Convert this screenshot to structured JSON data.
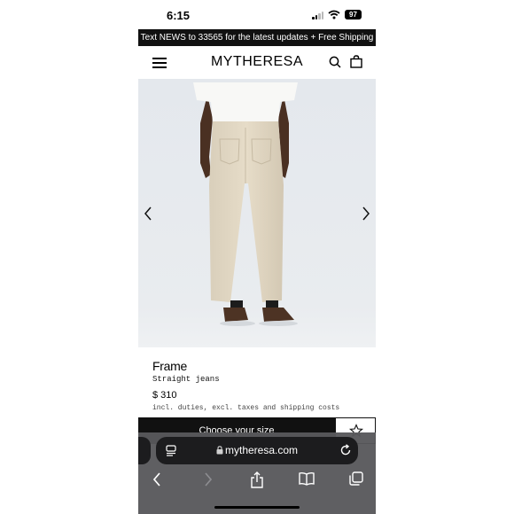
{
  "status_bar": {
    "time": "6:15",
    "battery": "97"
  },
  "promo_banner": {
    "text": "Text NEWS to 33565 for the latest updates + Free Shipping"
  },
  "header": {
    "logo": "MYTHERESA"
  },
  "product": {
    "brand": "Frame",
    "name": "Straight jeans",
    "price": "$ 310",
    "tax_note": "incl. duties, excl. taxes and shipping costs",
    "size_button_label": "Choose your size"
  },
  "browser": {
    "url": "mytheresa.com"
  },
  "icons": {
    "menu": "menu-icon",
    "search": "search-icon",
    "bag": "shopping-bag-icon",
    "prev": "chevron-left-icon",
    "next": "chevron-right-icon",
    "wishlist": "star-icon",
    "back": "back-icon",
    "forward": "forward-icon",
    "share": "share-icon",
    "bookmarks": "bookmarks-icon",
    "tabs": "tabs-icon"
  },
  "colors": {
    "banner_bg": "#111111",
    "image_bg": "#e7eaee",
    "browser_bar": "#58585c"
  }
}
